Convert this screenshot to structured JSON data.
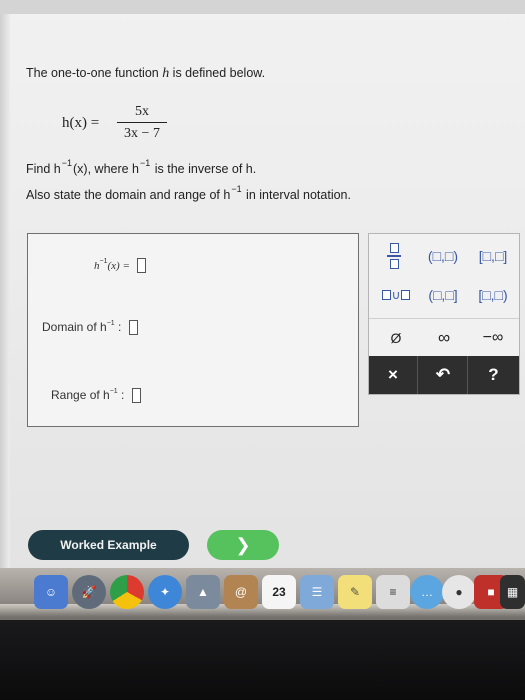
{
  "problem": {
    "intro_prefix": "The one-to-one function ",
    "intro_var": "h",
    "intro_suffix": " is defined below.",
    "fn_lhs": "h(x) =",
    "fn_numerator": "5x",
    "fn_denominator": "3x − 7",
    "find_prefix": "Find h",
    "find_sup": "−1",
    "find_mid": "(x), where h",
    "find_mid_sup": "−1",
    "find_suffix": " is the inverse of h.",
    "domain_prefix": "Also state the domain and range of h",
    "domain_sup": "−1",
    "domain_suffix": " in interval notation."
  },
  "answer": {
    "inverse_label": "h",
    "inverse_sup": "−1",
    "inverse_arg": "(x) =",
    "domain_label": "Domain of h",
    "domain_sup": "−1",
    "domain_colon": ":",
    "range_label": "Range of h",
    "range_sup": "−1",
    "range_colon": ":"
  },
  "palette": {
    "open_interval": "(□,□)",
    "closed_interval": "[□,□]",
    "union": "∪",
    "empty_set": "Ø",
    "infinity": "∞",
    "neg_infinity": "−∞",
    "clear": "×",
    "undo": "↶",
    "help": "?"
  },
  "buttons": {
    "worked_example": "Worked Example",
    "next": "❯"
  },
  "dock": {
    "calendar_day": "23"
  }
}
